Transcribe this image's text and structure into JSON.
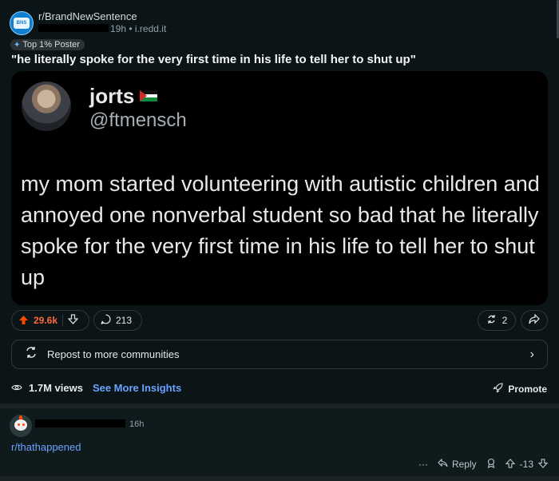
{
  "post": {
    "subreddit": "r/BrandNewSentence",
    "age": "19h",
    "domain": "i.redd.it",
    "flair": "Top 1% Poster",
    "title": "\"he literally spoke for the very first time in his life to tell her to shut up\"",
    "tweet": {
      "name": "jorts",
      "handle": "@ftmensch",
      "text": "my mom started volunteering with autistic children and annoyed one nonverbal student so bad that he literally spoke for the very first time in his life to tell her to shut up"
    },
    "upvotes": "29.6k",
    "comments": "213",
    "shares": "2",
    "repost_label": "Repost to more communities",
    "views": "1.7M views",
    "insights_label": "See More Insights",
    "promote_label": "Promote"
  },
  "comment": {
    "age": "16h",
    "body": "r/thathappened",
    "more": "···",
    "reply_label": "Reply",
    "score": "-13"
  },
  "icons": {
    "upvote": "arrow-up-icon",
    "downvote": "arrow-down-icon",
    "comment": "comment-bubble-icon",
    "share": "share-icon",
    "forward": "forward-icon",
    "repost": "repost-icon",
    "eye": "eye-icon",
    "promote": "rocket-icon",
    "award": "award-icon"
  },
  "colors": {
    "upvote_accent": "#ff4500",
    "link": "#6aa2ff",
    "background": "#0b1416"
  }
}
